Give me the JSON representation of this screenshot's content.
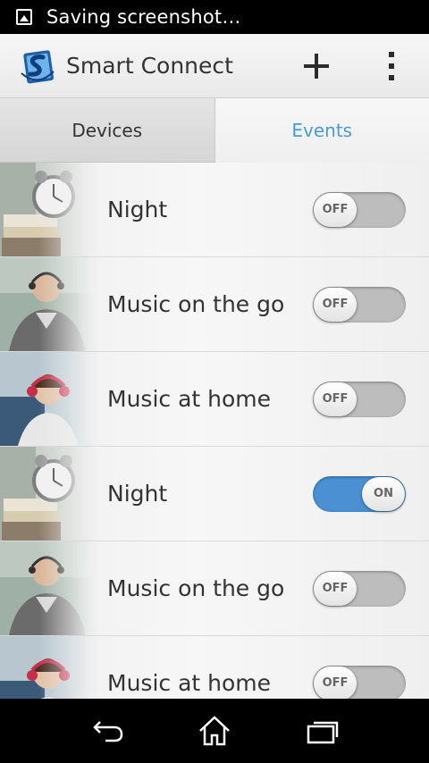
{
  "status_bar": {
    "text": "Saving screenshot…",
    "icon": "image-icon"
  },
  "action_bar": {
    "title": "Smart Connect",
    "add_icon": "add-icon",
    "more_icon": "overflow-menu-icon",
    "logo_icon": "smart-connect-logo-icon"
  },
  "tabs": [
    {
      "label": "Devices",
      "selected": false
    },
    {
      "label": "Events",
      "selected": true
    }
  ],
  "events": [
    {
      "label": "Night",
      "thumb": "alarm-clock",
      "state": "OFF"
    },
    {
      "label": "Music on the go",
      "thumb": "man-headphones",
      "state": "OFF"
    },
    {
      "label": "Music at home",
      "thumb": "woman-headphones",
      "state": "OFF"
    },
    {
      "label": "Night",
      "thumb": "alarm-clock",
      "state": "ON"
    },
    {
      "label": "Music on the go",
      "thumb": "man-headphones",
      "state": "OFF"
    },
    {
      "label": "Music at home",
      "thumb": "woman-headphones",
      "state": "OFF"
    }
  ],
  "nav_bar": {
    "back_icon": "back-icon",
    "home_icon": "home-icon",
    "recents_icon": "recent-apps-icon"
  },
  "colors": {
    "accent": "#4a9ad6",
    "toggle_on": "#4a90d2",
    "toggle_off": "#bdbdbd"
  }
}
